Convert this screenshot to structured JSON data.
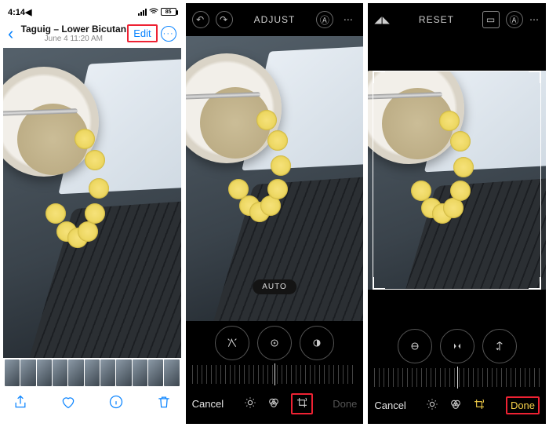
{
  "screen1": {
    "status_time": "4:14",
    "status_loc": "◀",
    "battery_pct": "85",
    "title_line1": "Taguig – Lower Bicutan",
    "title_line2": "June 4  11:20 AM",
    "edit_label": "Edit",
    "more_glyph": "···"
  },
  "screen2": {
    "top_center": "ADJUST",
    "auto_label": "AUTO",
    "bottom_cancel": "Cancel",
    "bottom_done": "Done"
  },
  "screen3": {
    "top_center": "RESET",
    "bottom_cancel": "Cancel",
    "bottom_done": "Done"
  }
}
